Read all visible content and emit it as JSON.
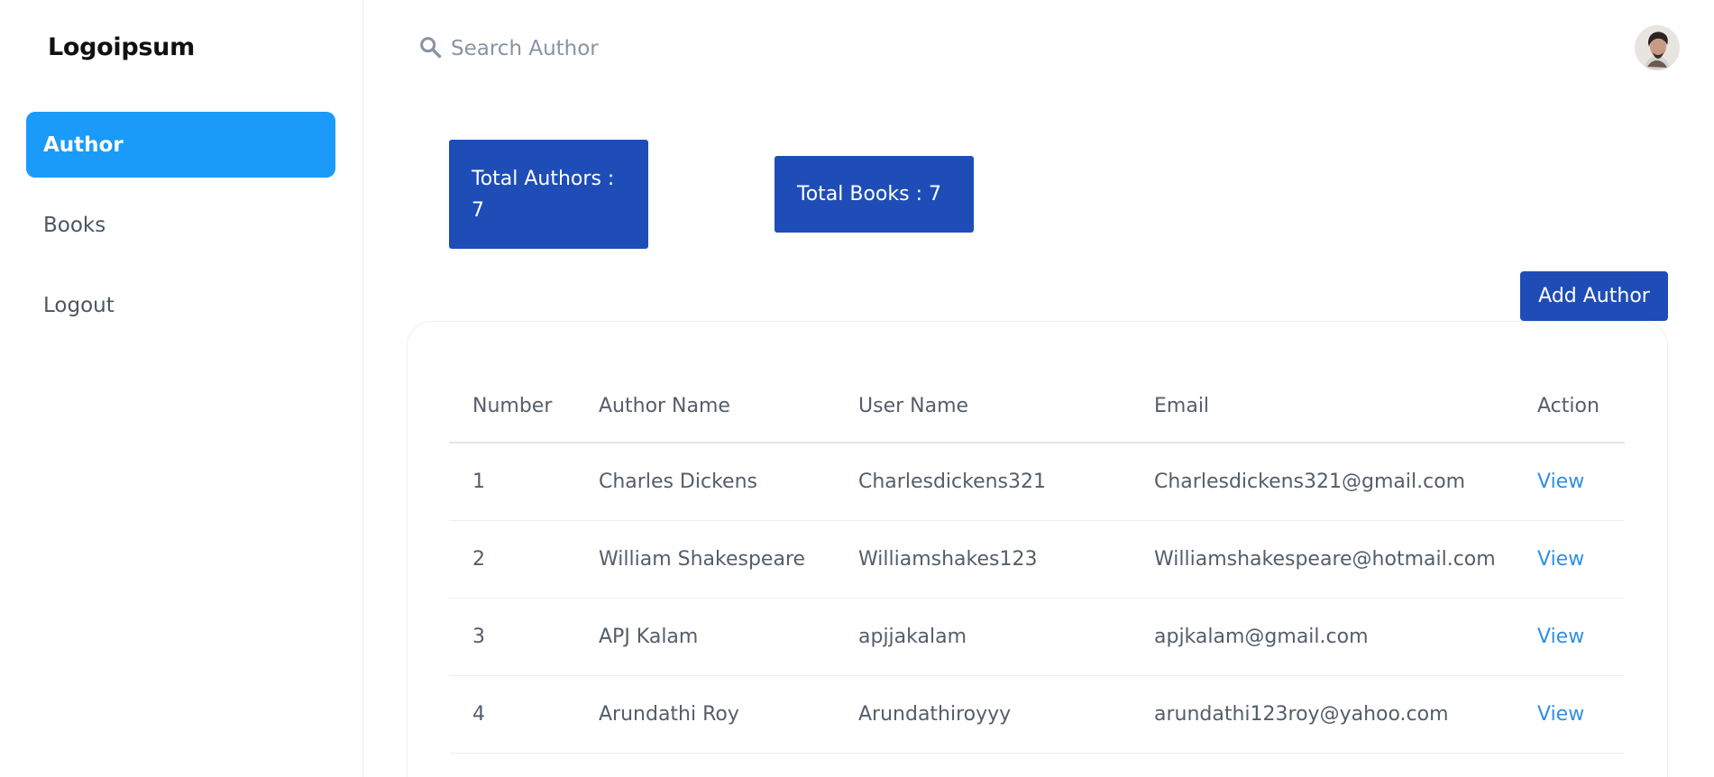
{
  "sidebar": {
    "logo": "Logoipsum",
    "items": [
      {
        "label": "Author",
        "active": true
      },
      {
        "label": "Books",
        "active": false
      },
      {
        "label": "Logout",
        "active": false
      }
    ]
  },
  "header": {
    "search_placeholder": "Search Author",
    "search_icon": "search-icon",
    "avatar_icon": "user-avatar"
  },
  "stats": {
    "total_authors": "Total Authors : 7",
    "total_books": "Total Books : 7"
  },
  "actions": {
    "add_author_label": "Add Author"
  },
  "table": {
    "columns": [
      "Number",
      "Author Name",
      "User Name",
      "Email",
      "Action"
    ],
    "rows": [
      {
        "number": "1",
        "name": "Charles Dickens",
        "username": "Charlesdickens321",
        "email": "Charlesdickens321@gmail.com",
        "action": "View"
      },
      {
        "number": "2",
        "name": "William Shakespeare",
        "username": "Williamshakes123",
        "email": "Williamshakespeare@hotmail.com",
        "action": "View"
      },
      {
        "number": "3",
        "name": "APJ Kalam",
        "username": "apjjakalam",
        "email": "apjkalam@gmail.com",
        "action": "View"
      },
      {
        "number": "4",
        "name": "Arundathi Roy",
        "username": "Arundathiroyyy",
        "email": "arundathi123roy@yahoo.com",
        "action": "View"
      }
    ]
  },
  "colors": {
    "sidebar_active": "#1a9bfa",
    "primary": "#1e4db7",
    "link": "#2f8fe8"
  }
}
